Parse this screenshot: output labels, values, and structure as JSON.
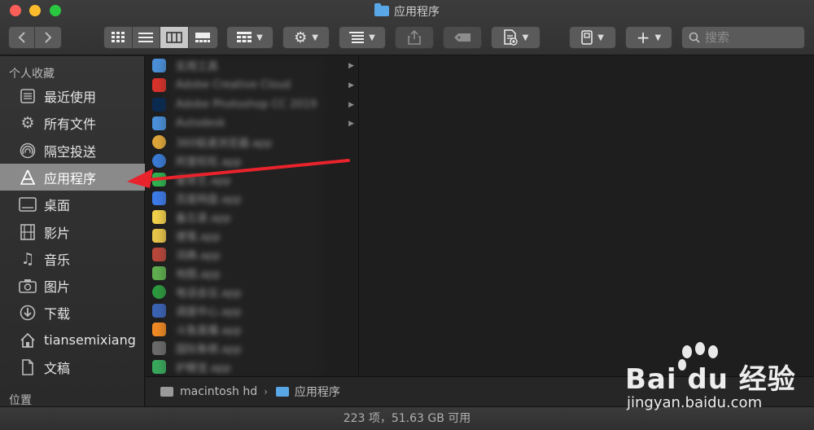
{
  "window": {
    "title": "应用程序"
  },
  "toolbar": {
    "back_icon": "chevron-left-icon",
    "forward_icon": "chevron-right-icon",
    "view_modes": [
      "icon-view",
      "list-view",
      "column-view",
      "gallery-view"
    ],
    "active_view": "column-view",
    "search_placeholder": "搜索"
  },
  "sidebar": {
    "favorites_header": "个人收藏",
    "items": [
      {
        "label": "最近使用",
        "icon": "recents-icon",
        "selected": false
      },
      {
        "label": "所有文件",
        "icon": "all-files-gear-icon",
        "selected": false
      },
      {
        "label": "隔空投送",
        "icon": "airdrop-icon",
        "selected": false
      },
      {
        "label": "应用程序",
        "icon": "applications-icon",
        "selected": true
      },
      {
        "label": "桌面",
        "icon": "desktop-icon",
        "selected": false
      },
      {
        "label": "影片",
        "icon": "movies-icon",
        "selected": false
      },
      {
        "label": "音乐",
        "icon": "music-icon",
        "selected": false
      },
      {
        "label": "图片",
        "icon": "pictures-icon",
        "selected": false
      },
      {
        "label": "下载",
        "icon": "downloads-icon",
        "selected": false
      },
      {
        "label": "tiansemixiang",
        "icon": "home-icon",
        "selected": false
      },
      {
        "label": "文稿",
        "icon": "documents-icon",
        "selected": false
      }
    ],
    "locations_header": "位置"
  },
  "file_list": {
    "rows": [
      {
        "name": "实用工具",
        "icon_color": "#4a90d9",
        "has_children": true
      },
      {
        "name": "Adobe Creative Cloud",
        "icon_color": "#d8322b",
        "has_children": true
      },
      {
        "name": "Adobe Photoshop CC 2019",
        "icon_color": "#0a2a52",
        "has_children": true
      },
      {
        "name": "Autodesk",
        "icon_color": "#4a90d9",
        "has_children": true
      },
      {
        "name": "360极速浏览器.app",
        "icon_color": "#e0a63a",
        "has_children": false
      },
      {
        "name": "阿里旺旺.app",
        "icon_color": "#3a7bd5",
        "has_children": false
      },
      {
        "name": "爱奇艺.app",
        "icon_color": "#2fb34f",
        "has_children": false
      },
      {
        "name": "百度网盘.app",
        "icon_color": "#3d7be8",
        "has_children": false
      },
      {
        "name": "备忘录.app",
        "icon_color": "#f2d14b",
        "has_children": false
      },
      {
        "name": "便笺.app",
        "icon_color": "#e8c54a",
        "has_children": false
      },
      {
        "name": "词典.app",
        "icon_color": "#b9473b",
        "has_children": false
      },
      {
        "name": "地图.app",
        "icon_color": "#5fae4f",
        "has_children": false
      },
      {
        "name": "电话会议.app",
        "icon_color": "#2c9a3f",
        "has_children": false
      },
      {
        "name": "调度中心.app",
        "icon_color": "#3b63b5",
        "has_children": false
      },
      {
        "name": "斗鱼直播.app",
        "icon_color": "#f08a24",
        "has_children": false
      },
      {
        "name": "国际象棋.app",
        "icon_color": "#6b6b6b",
        "has_children": false
      },
      {
        "name": "护眼宝.app",
        "icon_color": "#39a85c",
        "has_children": false
      }
    ]
  },
  "pathbar": {
    "drive": "macintosh hd",
    "folder": "应用程序"
  },
  "status": {
    "text": "223 项，51.63 GB 可用"
  },
  "watermark": {
    "main": "Bai du 经验",
    "sub": "jingyan.baidu.com"
  },
  "colors": {
    "selection": "#8a8a8a",
    "annotation_arrow": "#e8232c",
    "folder_blue": "#59a7e6"
  }
}
